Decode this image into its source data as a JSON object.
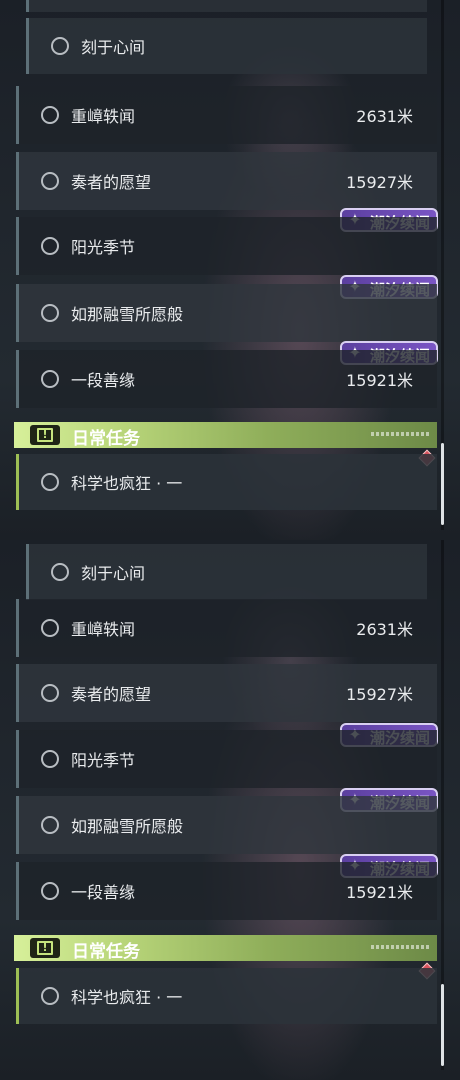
{
  "quests": {
    "first": {
      "label": "刻于心间"
    },
    "items": [
      {
        "label": "重嶂轶闻",
        "distance": "2631米"
      },
      {
        "label": "奏者的愿望",
        "distance": "15927米"
      },
      {
        "label": "阳光季节",
        "distance": ""
      },
      {
        "label": "如那融雪所愿般",
        "distance": ""
      },
      {
        "label": "一段善缘",
        "distance": "15921米"
      }
    ],
    "tide_badge": {
      "label": "潮汐续闻",
      "icon": "tide-star-icon",
      "color": "#6a4bb5"
    }
  },
  "daily": {
    "title": "日常任务",
    "icon": "alert-icon",
    "item": {
      "label": "科学也疯狂 · 一"
    },
    "accent": "#b9d67a"
  },
  "tracker_marker": {
    "icon": "diamond-marker-icon",
    "color": "#d8545e"
  }
}
